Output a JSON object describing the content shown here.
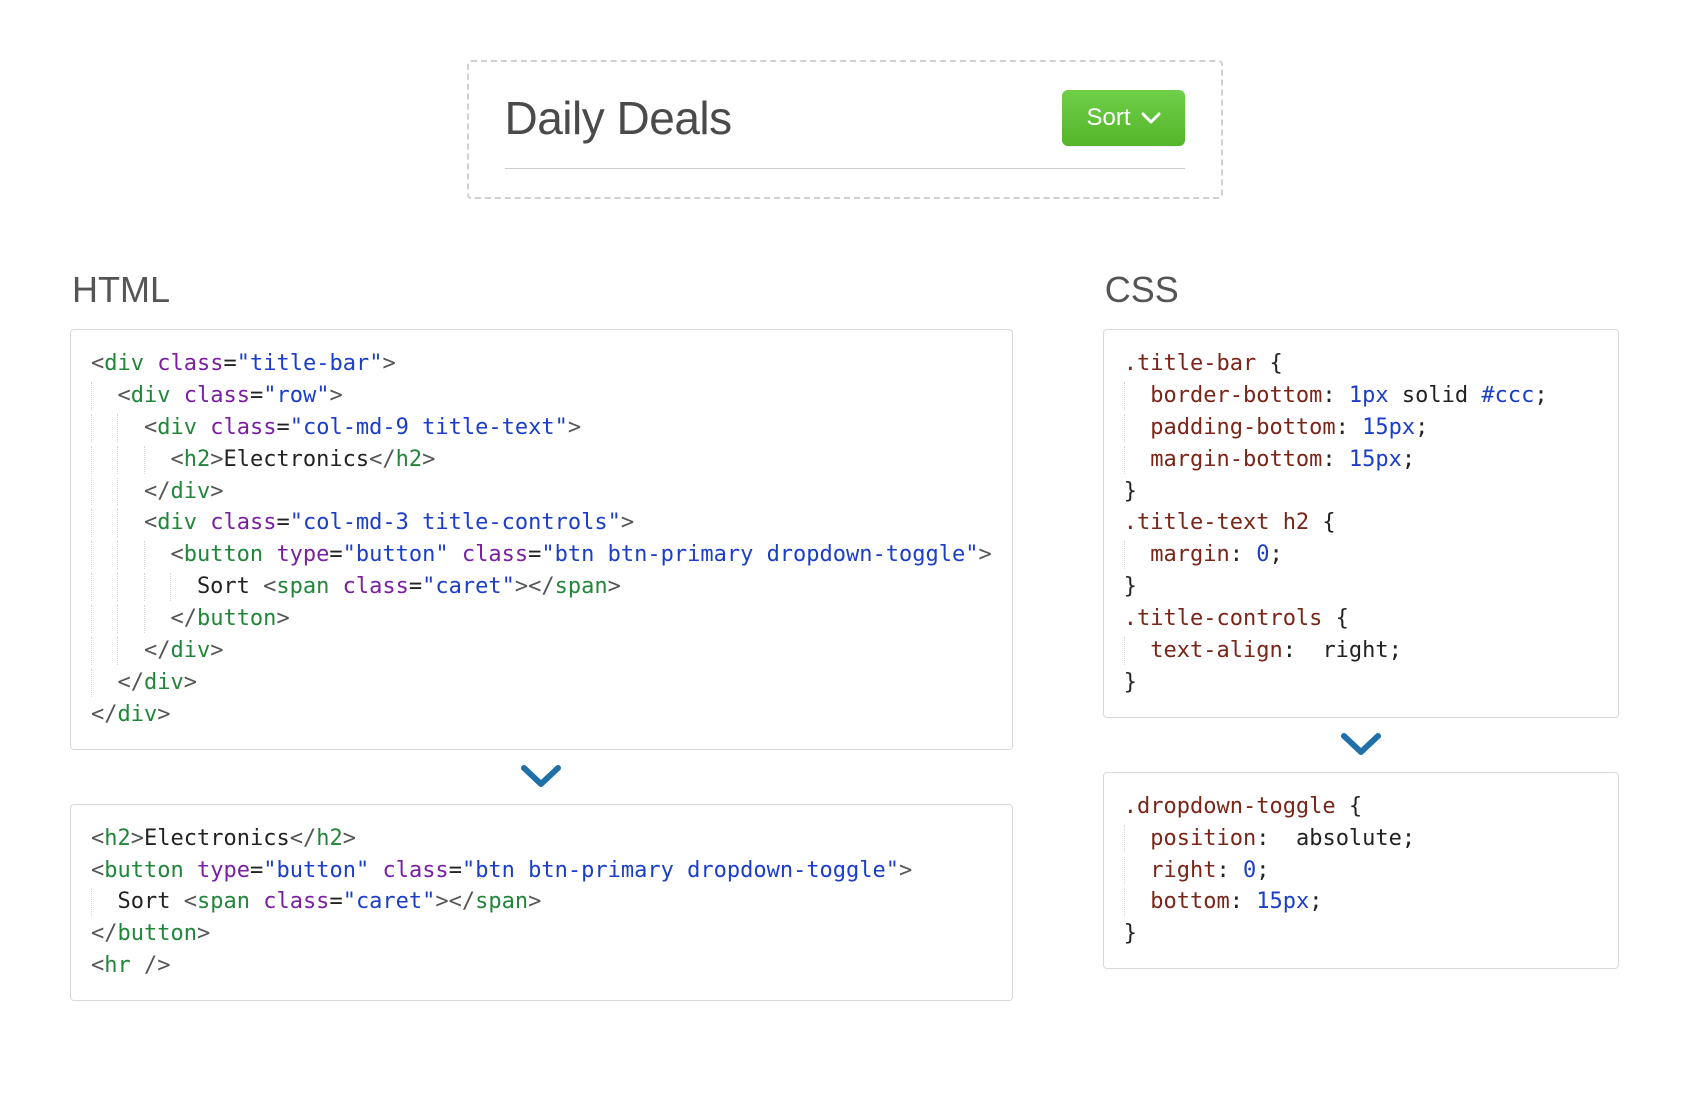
{
  "hero": {
    "title": "Daily Deals",
    "sort_label": "Sort"
  },
  "columns": {
    "html_heading": "HTML",
    "css_heading": "CSS"
  },
  "html_top": {
    "l1_open": "div",
    "l1_class": "title-bar",
    "l2_open": "div",
    "l2_class": "row",
    "l3_open": "div",
    "l3_class": "col-md-9 title-text",
    "l4_open": "h2",
    "l4_text": "Electronics",
    "l4_close": "h2",
    "l5_close": "div",
    "l6_open": "div",
    "l6_class": "col-md-3 title-controls",
    "l7_open": "button",
    "l7_type_attr": "type",
    "l7_type_val": "button",
    "l7_class": "btn btn-primary dropdown-toggle",
    "l8_text": "Sort ",
    "l8_span_open": "span",
    "l8_span_class": "caret",
    "l8_span_close": "span",
    "l9_close": "button",
    "l10_close": "div",
    "l11_close": "div",
    "l12_close": "div"
  },
  "html_bottom": {
    "l1_open": "h2",
    "l1_text": "Electronics",
    "l1_close": "h2",
    "l2_open": "button",
    "l2_type_attr": "type",
    "l2_type_val": "button",
    "l2_class": "btn btn-primary dropdown-toggle",
    "l3_text": "Sort ",
    "l3_span_open": "span",
    "l3_span_class": "caret",
    "l3_span_close": "span",
    "l4_close": "button",
    "l5_selfclose": "hr"
  },
  "css_top": {
    "r1_sel": ".title-bar",
    "r1_p1": "border-bottom",
    "r1_v1a": "1px",
    "r1_v1b": " solid ",
    "r1_v1c": "#ccc",
    "r1_p2": "padding-bottom",
    "r1_v2": "15px",
    "r1_p3": "margin-bottom",
    "r1_v3": "15px",
    "r2_sel": ".title-text h2",
    "r2_p1": "margin",
    "r2_v1": "0",
    "r3_sel": ".title-controls",
    "r3_p1": "text-align",
    "r3_v1": "right"
  },
  "css_bottom": {
    "sel": ".dropdown-toggle",
    "p1": "position",
    "v1": "absolute",
    "p2": "right",
    "v2": "0",
    "p3": "bottom",
    "v3": "15px"
  },
  "symbols": {
    "lt": "<",
    "gt": ">",
    "slash": "/",
    "eq": "=",
    "dq": "\"",
    "lbrace": " {",
    "rbrace": "}",
    "colon": ": ",
    "semi": ";",
    "space_selfclose": " /"
  }
}
